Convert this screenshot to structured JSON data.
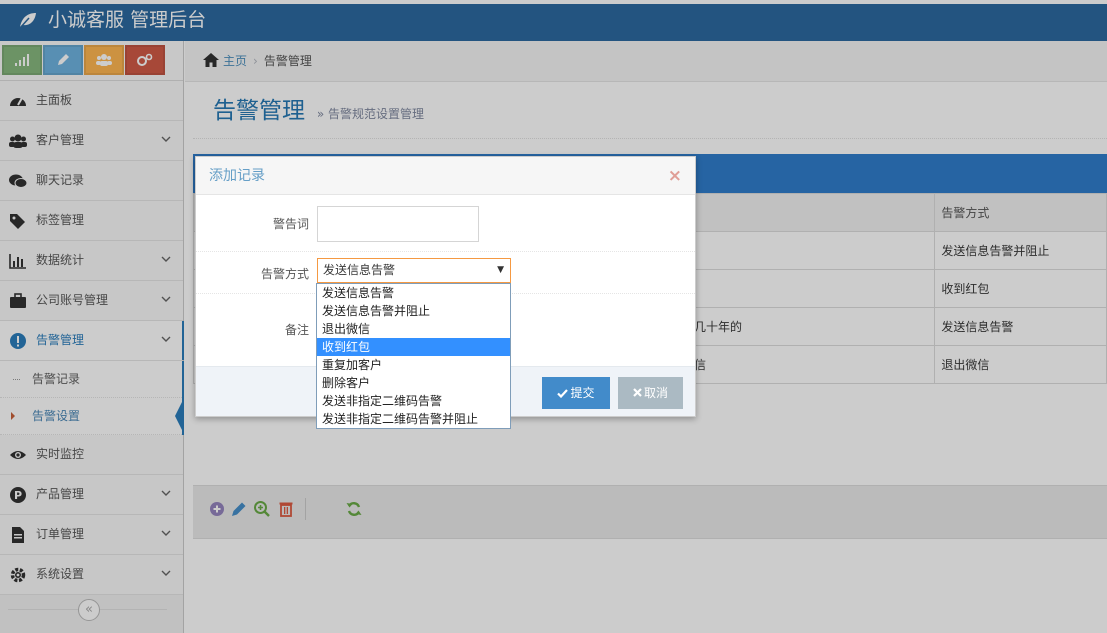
{
  "app": {
    "brand": "小诚客服 管理后台"
  },
  "colors": {
    "navbar": "#2c6aa0",
    "accent": "#2b7dbc",
    "title_bar": "#307ecc"
  },
  "sidebar": {
    "shortcuts": [
      "signal-icon",
      "pencil-icon",
      "users-icon",
      "cogs-icon"
    ],
    "items": [
      {
        "label": "主面板",
        "icon": "dashboard-icon",
        "has_children": false
      },
      {
        "label": "客户管理",
        "icon": "users-icon",
        "has_children": true
      },
      {
        "label": "聊天记录",
        "icon": "chat-icon",
        "has_children": false
      },
      {
        "label": "标签管理",
        "icon": "tag-icon",
        "has_children": false
      },
      {
        "label": "数据统计",
        "icon": "bar-chart-icon",
        "has_children": true
      },
      {
        "label": "公司账号管理",
        "icon": "briefcase-icon",
        "has_children": true
      },
      {
        "label": "告警管理",
        "icon": "exclamation-icon",
        "has_children": true
      }
    ],
    "sub_items": [
      {
        "label": "告警记录"
      },
      {
        "label": "告警设置"
      }
    ],
    "items_after": [
      {
        "label": "实时监控",
        "icon": "eye-icon",
        "has_children": false
      },
      {
        "label": "产品管理",
        "icon": "product-icon",
        "has_children": true
      },
      {
        "label": "订单管理",
        "icon": "file-icon",
        "has_children": true
      },
      {
        "label": "系统设置",
        "icon": "gear-icon",
        "has_children": true
      }
    ],
    "collapse_glyph": "«"
  },
  "breadcrumb": {
    "home": "主页",
    "current": "告警管理"
  },
  "page": {
    "title": "告警管理",
    "subtitle": "» 告警规范设置管理"
  },
  "grid": {
    "header": {
      "col2": "告警方式"
    },
    "rows": [
      {
        "col1": "",
        "col2": "发送信息告警并阻止"
      },
      {
        "col1": "",
        "col2": "收到红包"
      },
      {
        "col1": "几十年的",
        "col2": "发送信息告警"
      },
      {
        "col1": "信",
        "col2": "退出微信"
      }
    ]
  },
  "dialog": {
    "title": "添加记录",
    "close": "×",
    "fields": {
      "keyword_label": "警告词",
      "keyword_value": "",
      "method_label": "告警方式",
      "method_value": "发送信息告警",
      "note_label": "备注"
    },
    "submit": "提交",
    "cancel": "取消"
  },
  "dropdown": {
    "options": [
      "发送信息告警",
      "发送信息告警并阻止",
      "退出微信",
      "收到红包",
      "重复加客户",
      "删除客户",
      "发送非指定二维码告警",
      "发送非指定二维码告警并阻止"
    ],
    "highlighted_index": 3
  }
}
